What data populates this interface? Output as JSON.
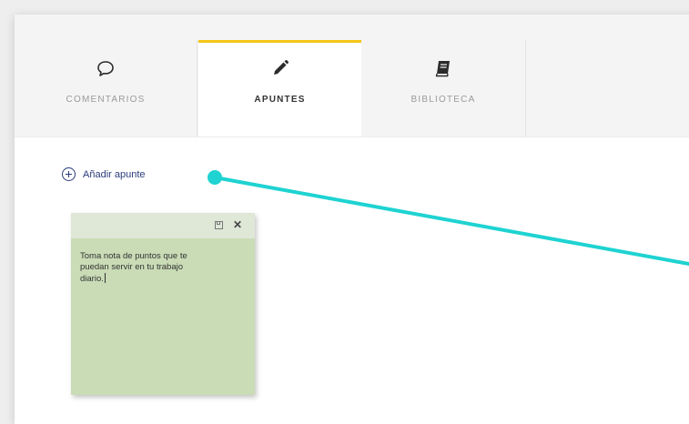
{
  "tabs": [
    {
      "label": "COMENTARIOS",
      "icon": "comment-icon",
      "active": false
    },
    {
      "label": "APUNTES",
      "icon": "pencil-icon",
      "active": true
    },
    {
      "label": "BIBLIOTECA",
      "icon": "book-icon",
      "active": false
    }
  ],
  "notes_panel": {
    "add_note_label": "Añadir apunte",
    "note": {
      "text": "Toma nota de puntos que te puedan servir en tu trabajo diario."
    }
  },
  "colors": {
    "active_tab_accent": "#f5c518",
    "note_background": "#c9dcb6",
    "pointer": "#1ed3d1",
    "link": "#2a3b7a"
  }
}
